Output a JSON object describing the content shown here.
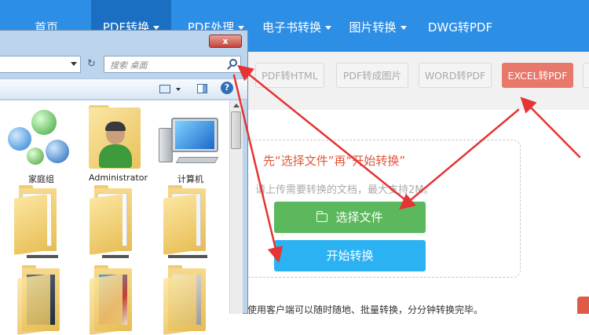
{
  "nav": {
    "items": [
      {
        "label": "首页",
        "dropdown": false
      },
      {
        "label": "PDF转换",
        "dropdown": true
      },
      {
        "label": "PDF处理",
        "dropdown": true
      },
      {
        "label": "电子书转换",
        "dropdown": true
      },
      {
        "label": "图片转换",
        "dropdown": true
      },
      {
        "label": "DWG转PDF",
        "dropdown": false
      }
    ],
    "active_index": 1,
    "color": "#2d8ee6"
  },
  "converters": {
    "items": [
      "PDF转HTML",
      "PDF转成图片",
      "WORD转PDF",
      "EXCEL转PDF"
    ],
    "active_label": "EXCEL转PDF",
    "active_color": "#e8786b"
  },
  "upload": {
    "title": "先“选择文件”再“开始转换”",
    "hint": "请上传需要转换的文档，最大支持2M。",
    "choose_label": "选择文件",
    "start_label": "开始转换",
    "choose_color": "#5cb85c",
    "start_color": "#2ab2f3"
  },
  "footer_text": "使用客户端可以随时随地、批量转换，分分钟转换完毕。",
  "explorer": {
    "close_glyph": "x",
    "refresh_glyph": "↻",
    "search_placeholder": "搜索 桌面",
    "help_glyph": "?",
    "icons": [
      {
        "label": "家庭组",
        "icon": "homegroup-icon"
      },
      {
        "label": "Administrator",
        "icon": "user-folder-icon"
      },
      {
        "label": "计算机",
        "icon": "computer-icon"
      }
    ]
  },
  "annotation_color": "#e63333"
}
